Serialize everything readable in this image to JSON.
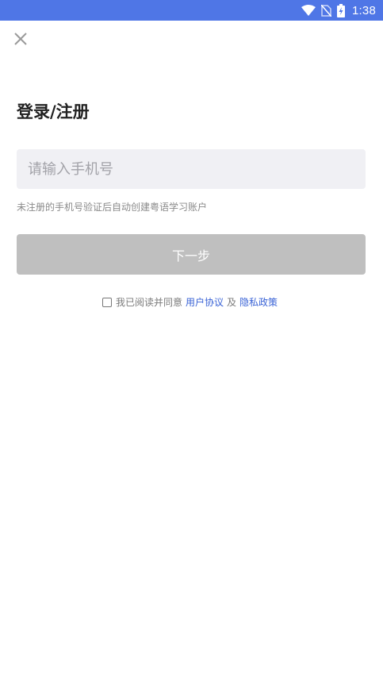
{
  "status_bar": {
    "time": "1:38",
    "icons": [
      "wifi-icon",
      "no-sim-icon",
      "battery-charging-icon"
    ],
    "background_color": "#4f76e6"
  },
  "header": {
    "close_icon": "close-icon"
  },
  "main": {
    "title": "登录/注册",
    "phone_placeholder": "请输入手机号",
    "phone_value": "",
    "hint": "未注册的手机号验证后自动创建粤语学习账户",
    "next_button_label": "下一步"
  },
  "agreement": {
    "checked": false,
    "prefix": "我已阅读并同意",
    "user_agreement": "用户协议",
    "conjunction": "及",
    "privacy_policy": "隐私政策",
    "link_color": "#3a63d6"
  }
}
